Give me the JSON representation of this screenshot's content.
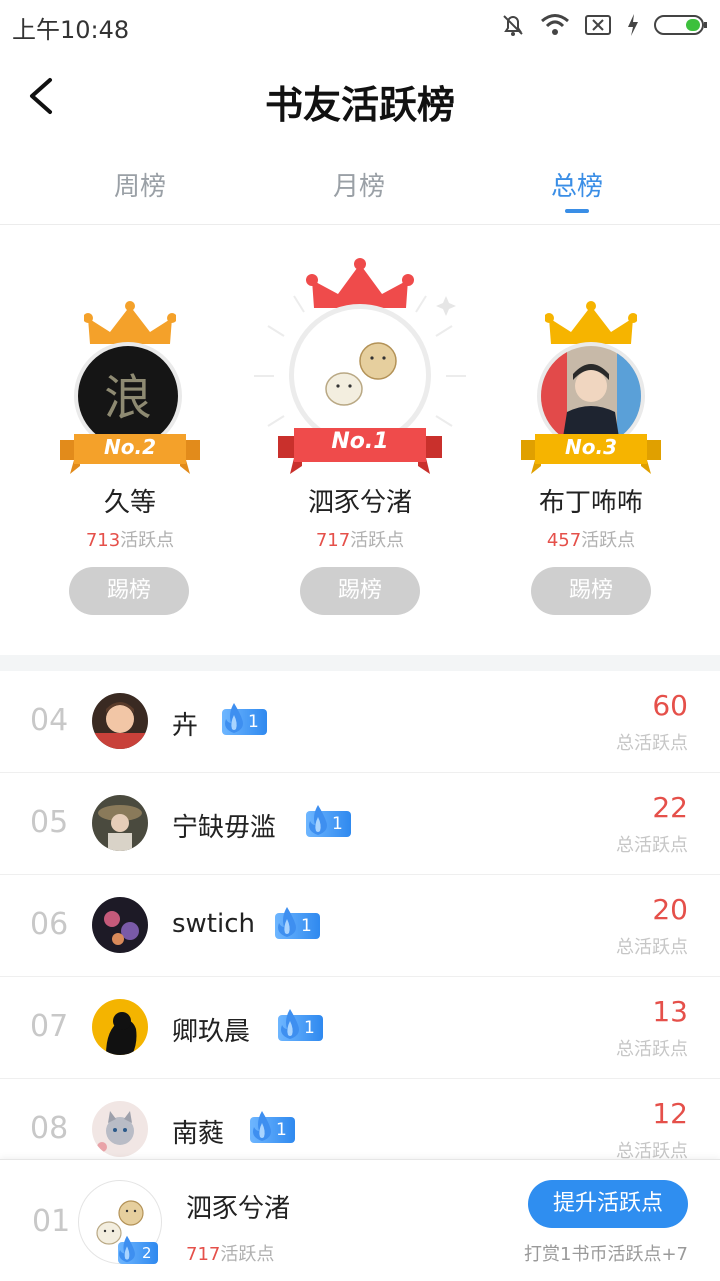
{
  "status_bar": {
    "time": "上午10:48",
    "icons": [
      "bell-muted-icon",
      "wifi-icon",
      "sim-x-icon",
      "charging-icon",
      "battery-icon"
    ]
  },
  "header": {
    "title": "书友活跃榜",
    "back_icon": "chevron-left-icon"
  },
  "tabs": [
    {
      "label": "周榜",
      "active": false
    },
    {
      "label": "月榜",
      "active": false
    },
    {
      "label": "总榜",
      "active": true
    }
  ],
  "podium": [
    {
      "rank_label": "No.2",
      "name": "久等",
      "score": "713",
      "score_unit": "活跃点",
      "button": "踢榜"
    },
    {
      "rank_label": "No.1",
      "name": "泗豕兮渚",
      "score": "717",
      "score_unit": "活跃点",
      "button": "踢榜"
    },
    {
      "rank_label": "No.3",
      "name": "布丁咘咘",
      "score": "457",
      "score_unit": "活跃点",
      "button": "踢榜"
    }
  ],
  "ranking": [
    {
      "rank": "04",
      "name": "卉",
      "level": "1",
      "value": "60",
      "unit": "总活跃点"
    },
    {
      "rank": "05",
      "name": "宁缺毋滥",
      "level": "1",
      "value": "22",
      "unit": "总活跃点"
    },
    {
      "rank": "06",
      "name": "swtich",
      "level": "1",
      "value": "20",
      "unit": "总活跃点"
    },
    {
      "rank": "07",
      "name": "卿玖晨",
      "level": "1",
      "value": "13",
      "unit": "总活跃点"
    },
    {
      "rank": "08",
      "name": "南蕤",
      "level": "1",
      "value": "12",
      "unit": "总活跃点"
    }
  ],
  "my_rank": {
    "rank": "01",
    "name": "泗豕兮渚",
    "level": "2",
    "score": "717",
    "score_unit": "活跃点",
    "button": "提升活跃点",
    "hint": "打赏1书币活跃点+7"
  },
  "colors": {
    "accent": "#3a8ee6",
    "score_red": "#e5504a",
    "gold_crown": "#f6b400",
    "silver_crown": "#f4a12a",
    "first_crown": "#ef4b4b"
  }
}
